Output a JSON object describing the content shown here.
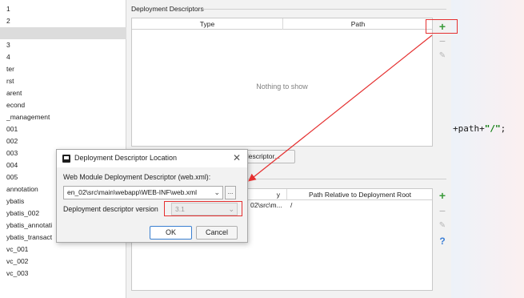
{
  "left_tree": {
    "items": [
      {
        "label": "1",
        "selected": false
      },
      {
        "label": "2",
        "selected": false
      },
      {
        "label": "",
        "selected": true
      },
      {
        "label": "3",
        "selected": false
      },
      {
        "label": "4",
        "selected": false
      },
      {
        "label": "ter",
        "selected": false
      },
      {
        "label": "rst",
        "selected": false
      },
      {
        "label": "arent",
        "selected": false
      },
      {
        "label": "econd",
        "selected": false
      },
      {
        "label": "_management",
        "selected": false
      },
      {
        "label": "001",
        "selected": false
      },
      {
        "label": "002",
        "selected": false
      },
      {
        "label": "003",
        "selected": false
      },
      {
        "label": "004",
        "selected": false
      },
      {
        "label": "005",
        "selected": false
      },
      {
        "label": "annotation",
        "selected": false
      },
      {
        "label": "ybatis",
        "selected": false
      },
      {
        "label": "ybatis_002",
        "selected": false
      },
      {
        "label": "ybatis_annotati",
        "selected": false
      },
      {
        "label": "ybatis_transact",
        "selected": false
      },
      {
        "label": "vc_001",
        "selected": false
      },
      {
        "label": "vc_002",
        "selected": false
      },
      {
        "label": "vc_003",
        "selected": false
      }
    ]
  },
  "deployment_descriptors": {
    "title": "Deployment Descriptors",
    "columns": [
      "Type",
      "Path"
    ],
    "empty_text": "Nothing to show",
    "toolbar": {
      "add_icon": "plus-icon",
      "remove_icon": "minus-icon",
      "edit_icon": "pencil-icon"
    },
    "add_button_label": "descriptor..."
  },
  "web_resource_dirs": {
    "columns": [
      "y",
      "Path Relative to Deployment Root"
    ],
    "rows": [
      {
        "directory": "02\\src\\m...",
        "path": "/"
      }
    ],
    "toolbar": {
      "add_icon": "plus-icon",
      "remove_icon": "minus-icon",
      "edit_icon": "pencil-icon",
      "help_icon": "help-icon"
    }
  },
  "editor": {
    "code_prefix": "+path+",
    "code_string": "\"/\"",
    "code_suffix": ";"
  },
  "dialog": {
    "title": "Deployment Descriptor Location",
    "close_glyph": "✕",
    "descriptor_label": "Web Module Deployment Descriptor (web.xml):",
    "descriptor_value": "en_02\\src\\main\\webapp\\WEB-INF\\web.xml",
    "browse_label": "...",
    "version_label": "Deployment descriptor version",
    "version_value": "3.1",
    "ok_label": "OK",
    "cancel_label": "Cancel"
  },
  "colors": {
    "annotation_red": "#e53030",
    "add_green": "#3a9a3a",
    "help_blue": "#3d7fd6"
  }
}
